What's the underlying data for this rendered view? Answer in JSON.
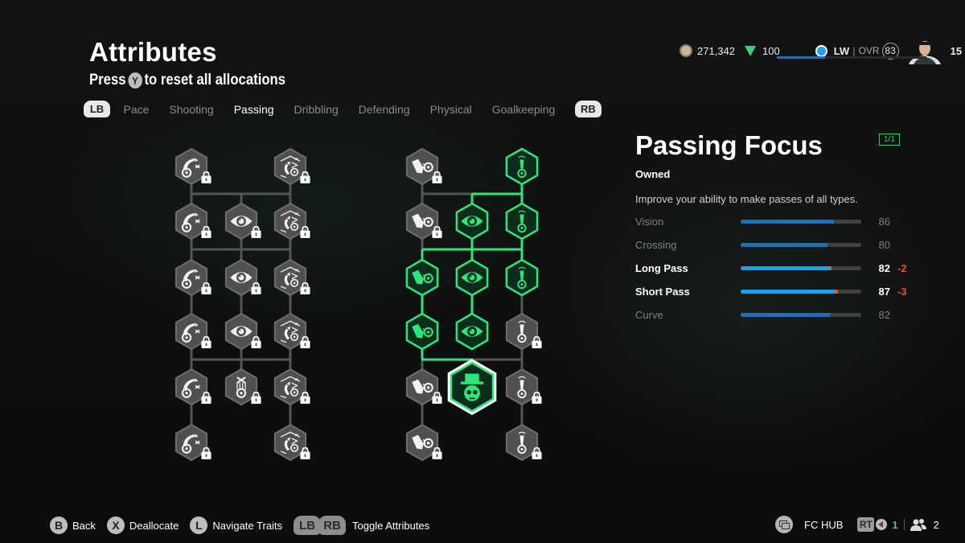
{
  "header": {
    "title": "Attributes",
    "subtitle_prefix": "Press",
    "subtitle_button": "Y",
    "subtitle_suffix": "to reset all allocations"
  },
  "tabs": {
    "left_bumper": "LB",
    "right_bumper": "RB",
    "items": [
      {
        "label": "Pace",
        "active": false
      },
      {
        "label": "Shooting",
        "active": false
      },
      {
        "label": "Passing",
        "active": true
      },
      {
        "label": "Dribbling",
        "active": false
      },
      {
        "label": "Defending",
        "active": false
      },
      {
        "label": "Physical",
        "active": false
      },
      {
        "label": "Goalkeeping",
        "active": false
      }
    ]
  },
  "topbar": {
    "coins": "271,342",
    "points": "100",
    "position": "LW",
    "ovr_label": "OVR",
    "ovr_value": "83",
    "level": "15",
    "level_progress": 0.32,
    "position_color": "#1ea1f1"
  },
  "trees": {
    "left": {
      "nodes": [
        {
          "row": 0,
          "col": 0,
          "icon": "curved-ball-icon",
          "state": "locked"
        },
        {
          "row": 0,
          "col": 2,
          "icon": "pitch-curve-icon",
          "state": "locked"
        },
        {
          "row": 1,
          "col": 0,
          "icon": "curved-ball-icon",
          "state": "locked"
        },
        {
          "row": 1,
          "col": 1,
          "icon": "eye-icon",
          "state": "locked"
        },
        {
          "row": 1,
          "col": 2,
          "icon": "pitch-curve-icon",
          "state": "locked"
        },
        {
          "row": 2,
          "col": 0,
          "icon": "curved-ball-icon",
          "state": "locked"
        },
        {
          "row": 2,
          "col": 1,
          "icon": "eye-icon",
          "state": "locked"
        },
        {
          "row": 2,
          "col": 2,
          "icon": "pitch-curve-icon",
          "state": "locked"
        },
        {
          "row": 3,
          "col": 0,
          "icon": "curved-ball-icon",
          "state": "locked"
        },
        {
          "row": 3,
          "col": 1,
          "icon": "eye-icon",
          "state": "locked"
        },
        {
          "row": 3,
          "col": 2,
          "icon": "pitch-curve-icon",
          "state": "locked"
        },
        {
          "row": 4,
          "col": 0,
          "icon": "curved-ball-icon",
          "state": "locked"
        },
        {
          "row": 4,
          "col": 1,
          "icon": "ball-drop-icon",
          "state": "locked"
        },
        {
          "row": 4,
          "col": 2,
          "icon": "pitch-curve-icon",
          "state": "locked"
        },
        {
          "row": 5,
          "col": 0,
          "icon": "curved-ball-icon",
          "state": "locked"
        },
        {
          "row": 5,
          "col": 2,
          "icon": "pitch-curve-icon",
          "state": "locked"
        }
      ]
    },
    "right": {
      "nodes": [
        {
          "row": 0,
          "col": 0,
          "icon": "boot-ball-icon",
          "state": "locked"
        },
        {
          "row": 0,
          "col": 2,
          "icon": "long-ball-icon",
          "state": "owned"
        },
        {
          "row": 1,
          "col": 0,
          "icon": "boot-ball-icon",
          "state": "locked"
        },
        {
          "row": 1,
          "col": 1,
          "icon": "eye-icon",
          "state": "owned"
        },
        {
          "row": 1,
          "col": 2,
          "icon": "long-ball-icon",
          "state": "owned"
        },
        {
          "row": 2,
          "col": 0,
          "icon": "boot-ball-icon",
          "state": "owned"
        },
        {
          "row": 2,
          "col": 1,
          "icon": "eye-icon",
          "state": "owned"
        },
        {
          "row": 2,
          "col": 2,
          "icon": "long-ball-icon",
          "state": "owned"
        },
        {
          "row": 3,
          "col": 0,
          "icon": "boot-ball-icon",
          "state": "owned"
        },
        {
          "row": 3,
          "col": 1,
          "icon": "eye-icon",
          "state": "owned"
        },
        {
          "row": 3,
          "col": 2,
          "icon": "long-ball-icon",
          "state": "locked"
        },
        {
          "row": 4,
          "col": 0,
          "icon": "boot-ball-icon",
          "state": "locked"
        },
        {
          "row": 4,
          "col": 1,
          "icon": "top-hat-skull-icon",
          "state": "selected"
        },
        {
          "row": 4,
          "col": 2,
          "icon": "long-ball-icon",
          "state": "locked"
        },
        {
          "row": 5,
          "col": 0,
          "icon": "boot-ball-icon",
          "state": "locked"
        },
        {
          "row": 5,
          "col": 2,
          "icon": "long-ball-icon",
          "state": "locked"
        }
      ]
    }
  },
  "panel": {
    "title": "Passing Focus",
    "count": "1/1",
    "status": "Owned",
    "description": "Improve your ability to make passes of all types.",
    "stats": [
      {
        "name": "Vision",
        "value": "86",
        "delta": "",
        "highlight": false,
        "loss": 0
      },
      {
        "name": "Crossing",
        "value": "80",
        "delta": "",
        "highlight": false,
        "loss": 0
      },
      {
        "name": "Long Pass",
        "value": "82",
        "delta": "-2",
        "highlight": true,
        "loss": 2
      },
      {
        "name": "Short Pass",
        "value": "87",
        "delta": "-3",
        "highlight": true,
        "loss": 3
      },
      {
        "name": "Curve",
        "value": "82",
        "delta": "",
        "highlight": false,
        "loss": 0
      }
    ]
  },
  "footer": {
    "hints": [
      {
        "button": "B",
        "label": "Back"
      },
      {
        "button": "X",
        "label": "Deallocate"
      },
      {
        "button": "L",
        "label": "Navigate Traits"
      }
    ],
    "toggle_buttons": [
      "LB",
      "RB"
    ],
    "toggle_label": "Toggle Attributes",
    "hub_label": "FC HUB",
    "rt_label": "RT",
    "mic_count": "1",
    "party_count": "2"
  },
  "colors": {
    "accent_green": "#2ee57a",
    "loss_red": "#e5502e",
    "bar_blue": "#1aa0ef"
  }
}
